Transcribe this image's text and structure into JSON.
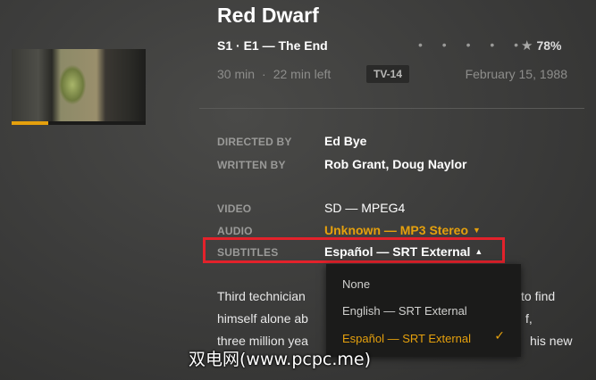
{
  "show": {
    "title": "Red Dwarf",
    "episode": "S1 · E1 — The End",
    "rating_dots": "• • • • •",
    "rating": "78%",
    "duration": "30 min",
    "time_left": "22 min left",
    "content_rating": "TV-14",
    "air_date": "February 15, 1988",
    "progress_fraction": 0.27
  },
  "credits": {
    "directed_by_label": "DIRECTED BY",
    "directed_by": "Ed Bye",
    "written_by_label": "WRITTEN BY",
    "written_by": "Rob Grant, Doug Naylor"
  },
  "media": {
    "video_label": "VIDEO",
    "video": "SD — MPEG4",
    "audio_label": "AUDIO",
    "audio": "Unknown — MP3 Stereo",
    "subtitles_label": "SUBTITLES",
    "subtitles": "Español — SRT External"
  },
  "summary": {
    "line1": "Third technician",
    "line1_end": "to find",
    "line2": "himself alone ab",
    "line2_end": "f,",
    "line3": "three million yea",
    "line3_end": "his new"
  },
  "subtitle_menu": {
    "options": [
      "None",
      "English — SRT External",
      "Español — SRT External"
    ],
    "selected_index": 2
  },
  "watermark": "双电网(www.pcpc.me)",
  "colors": {
    "accent": "#e5a00d",
    "highlight_border": "#e3222b"
  },
  "icons": {
    "rating": "star-icon",
    "dropdown": "caret-down-icon",
    "dropdown_open": "caret-up-icon",
    "selected": "checkmark-icon"
  }
}
